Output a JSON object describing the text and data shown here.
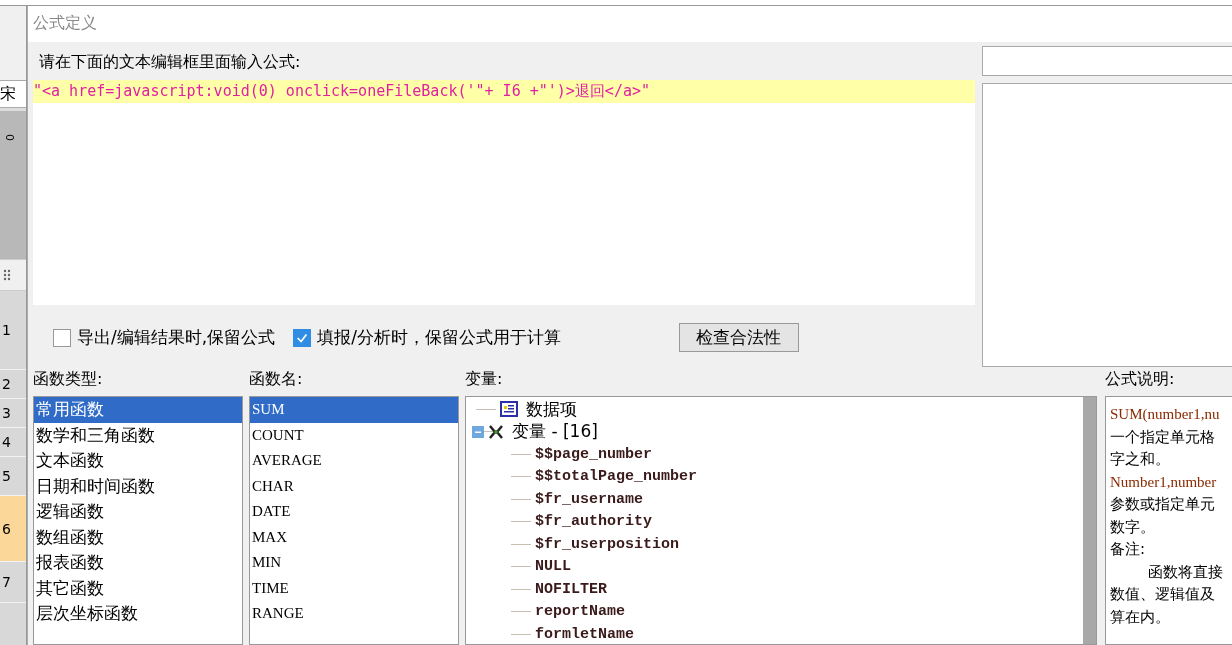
{
  "background": {
    "font_field": "宋",
    "ruler_label": "0",
    "row_headers": [
      {
        "label": "1",
        "selected": false
      },
      {
        "label": "2",
        "selected": false
      },
      {
        "label": "3",
        "selected": false
      },
      {
        "label": "4",
        "selected": false
      },
      {
        "label": "5",
        "selected": false
      },
      {
        "label": "6",
        "selected": true
      },
      {
        "label": "7",
        "selected": false
      }
    ]
  },
  "dialog": {
    "title": "公式定义",
    "prompt": "请在下面的文本编辑框里面输入公式:",
    "formula": "\"<a href=javascript:void(0) onclick=oneFileBack('\"+ I6 +\"')>退回</a>\"",
    "options": [
      {
        "label": "导出/编辑结果时,保留公式",
        "checked": false
      },
      {
        "label": "填报/分析时，保留公式用于计算",
        "checked": true
      }
    ],
    "check_button": "检查合法性",
    "function_types": {
      "label": "函数类型:",
      "items": [
        {
          "label": "常用函数",
          "selected": true
        },
        {
          "label": "数学和三角函数",
          "selected": false
        },
        {
          "label": "文本函数",
          "selected": false
        },
        {
          "label": "日期和时间函数",
          "selected": false
        },
        {
          "label": "逻辑函数",
          "selected": false
        },
        {
          "label": "数组函数",
          "selected": false
        },
        {
          "label": "报表函数",
          "selected": false
        },
        {
          "label": "其它函数",
          "selected": false
        },
        {
          "label": "层次坐标函数",
          "selected": false
        }
      ]
    },
    "function_names": {
      "label": "函数名:",
      "items": [
        {
          "label": "SUM",
          "selected": true
        },
        {
          "label": "COUNT",
          "selected": false
        },
        {
          "label": "AVERAGE",
          "selected": false
        },
        {
          "label": "CHAR",
          "selected": false
        },
        {
          "label": "DATE",
          "selected": false
        },
        {
          "label": "MAX",
          "selected": false
        },
        {
          "label": "MIN",
          "selected": false
        },
        {
          "label": "TIME",
          "selected": false
        },
        {
          "label": "RANGE",
          "selected": false
        }
      ]
    },
    "variables": {
      "label": "变量:",
      "tree": [
        {
          "label": "数据项",
          "kind": "data"
        },
        {
          "label": "变量 - [16]",
          "kind": "variables",
          "expanded": true,
          "children": [
            {
              "label": "$$page_number"
            },
            {
              "label": "$$totalPage_number"
            },
            {
              "label": "$fr_username"
            },
            {
              "label": "$fr_authority"
            },
            {
              "label": "$fr_userposition"
            },
            {
              "label": "NULL"
            },
            {
              "label": "NOFILTER"
            },
            {
              "label": "reportName"
            },
            {
              "label": "formletName"
            }
          ]
        }
      ]
    },
    "description": {
      "label": "公式说明:",
      "lines": [
        {
          "text": "SUM(number1,nu",
          "kind": "code"
        },
        {
          "text": "一个指定单元格",
          "kind": "text"
        },
        {
          "text": "字之和。",
          "kind": "text"
        },
        {
          "text": "Number1,number",
          "kind": "code"
        },
        {
          "text": "参数或指定单元",
          "kind": "text"
        },
        {
          "text": "数字。",
          "kind": "text"
        },
        {
          "text": "备注:",
          "kind": "text"
        },
        {
          "text": "函数将直接",
          "kind": "indent"
        },
        {
          "text": "数值、逻辑值及",
          "kind": "text"
        },
        {
          "text": "算在内。",
          "kind": "text"
        }
      ]
    }
  }
}
